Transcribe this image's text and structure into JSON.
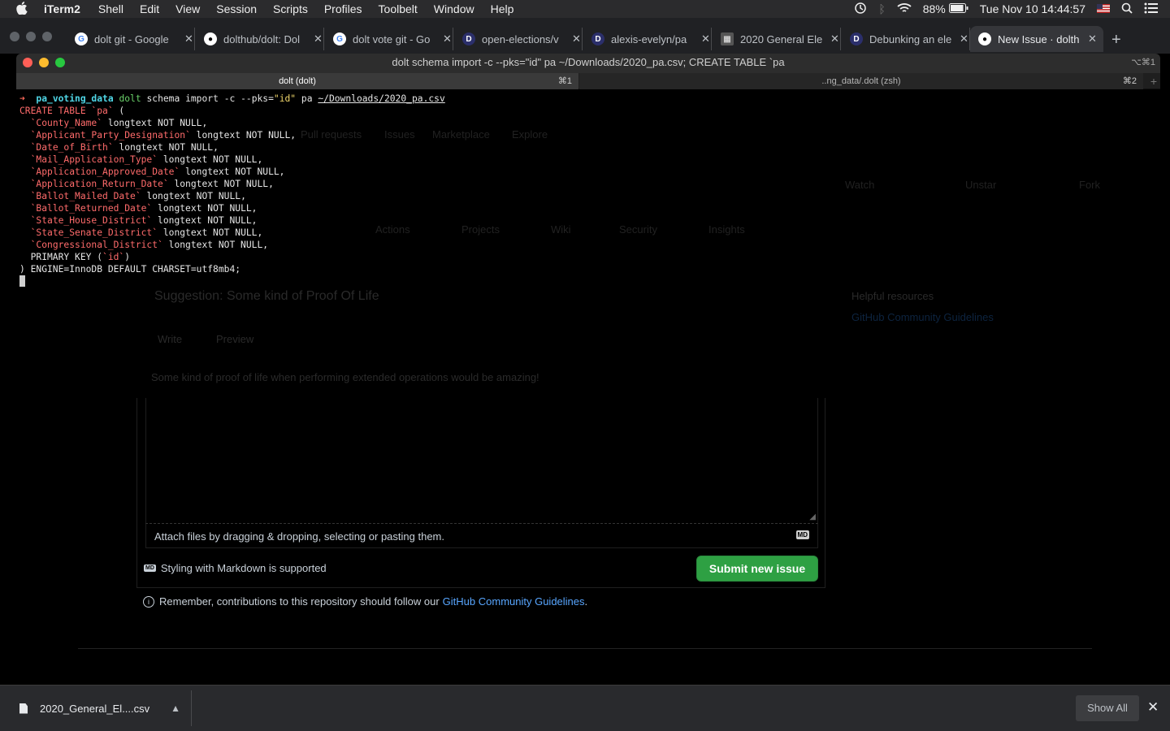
{
  "menubar": {
    "app": "iTerm2",
    "items": [
      "Shell",
      "Edit",
      "View",
      "Session",
      "Scripts",
      "Profiles",
      "Toolbelt",
      "Window",
      "Help"
    ],
    "battery": "88%",
    "clock": "Tue Nov 10  14:44:57"
  },
  "browser_tabs": [
    {
      "title": "dolt git - Google",
      "icon": "google-icon"
    },
    {
      "title": "dolthub/dolt: Dol",
      "icon": "github-icon"
    },
    {
      "title": "dolt vote git - Go",
      "icon": "google-icon"
    },
    {
      "title": "open-elections/v",
      "icon": "dolthub-icon"
    },
    {
      "title": "alexis-evelyn/pa",
      "icon": "dolthub-icon"
    },
    {
      "title": "2020 General Ele",
      "icon": "grid-icon"
    },
    {
      "title": "Debunking an ele",
      "icon": "dolthub-icon"
    },
    {
      "title": "New Issue · dolth",
      "icon": "github-icon",
      "active": true
    }
  ],
  "iterm": {
    "window_title": "dolt schema import -c --pks=\"id\" pa ~/Downloads/2020_pa.csv; CREATE TABLE `pa",
    "window_shortcut": "⌥⌘1",
    "tab1": {
      "label": "dolt (dolt)",
      "shortcut": "⌘1"
    },
    "tab2": {
      "label": "..ng_data/.dolt (zsh)",
      "shortcut": "⌘2"
    },
    "prompt_arrow": "➜",
    "prompt_dir": "pa_voting_data",
    "command": "dolt",
    "command_args": " schema import -c --pks=",
    "command_pks": "\"id\"",
    "command_rest": " pa ",
    "command_path": "~/Downloads/2020_pa.csv",
    "create_line_kw": "CREATE TABLE `pa`",
    "create_line_rest": " (",
    "columns": [
      {
        "name": "`County_Name`",
        "type": " longtext NOT NULL,"
      },
      {
        "name": "`Applicant_Party_Designation`",
        "type": " longtext NOT NULL,"
      },
      {
        "name": "`Date_of_Birth`",
        "type": " longtext NOT NULL,"
      },
      {
        "name": "`Mail_Application_Type`",
        "type": " longtext NOT NULL,"
      },
      {
        "name": "`Application_Approved_Date`",
        "type": " longtext NOT NULL,"
      },
      {
        "name": "`Application_Return_Date`",
        "type": " longtext NOT NULL,"
      },
      {
        "name": "`Ballot_Mailed_Date`",
        "type": " longtext NOT NULL,"
      },
      {
        "name": "`Ballot_Returned_Date`",
        "type": " longtext NOT NULL,"
      },
      {
        "name": "`State_House_District`",
        "type": " longtext NOT NULL,"
      },
      {
        "name": "`State_Senate_District`",
        "type": " longtext NOT NULL,"
      },
      {
        "name": "`Congressional_District`",
        "type": " longtext NOT NULL,"
      }
    ],
    "primary_key_pre": "  PRIMARY KEY (",
    "primary_key_col": "`id`",
    "primary_key_post": ")",
    "engine_line": ") ENGINE=InnoDB DEFAULT CHARSET=utf8mb4;"
  },
  "github": {
    "nav": [
      "Pull requests",
      "Issues",
      "Marketplace",
      "Explore"
    ],
    "repo_actions": [
      "Watch",
      "Unstar",
      "Fork"
    ],
    "repo_tabs": [
      "Actions",
      "Projects",
      "Wiki",
      "Security",
      "Insights"
    ],
    "issue_title": "Suggestion: Some kind of Proof Of Life",
    "editor_tabs": [
      "Write",
      "Preview"
    ],
    "body_text": "Some kind of proof of life when performing extended operations would be amazing!",
    "sidebar_heading": "Helpful resources",
    "sidebar_link": "GitHub Community Guidelines",
    "attach_text": "Attach files by dragging & dropping, selecting or pasting them.",
    "markdown_note": "Styling with Markdown is supported",
    "submit_label": "Submit new issue",
    "remember_text": "Remember, contributions to this repository should follow our",
    "remember_link": "GitHub Community Guidelines",
    "md_badge": "MD"
  },
  "download": {
    "filename": "2020_General_El....csv",
    "show_all": "Show All"
  }
}
